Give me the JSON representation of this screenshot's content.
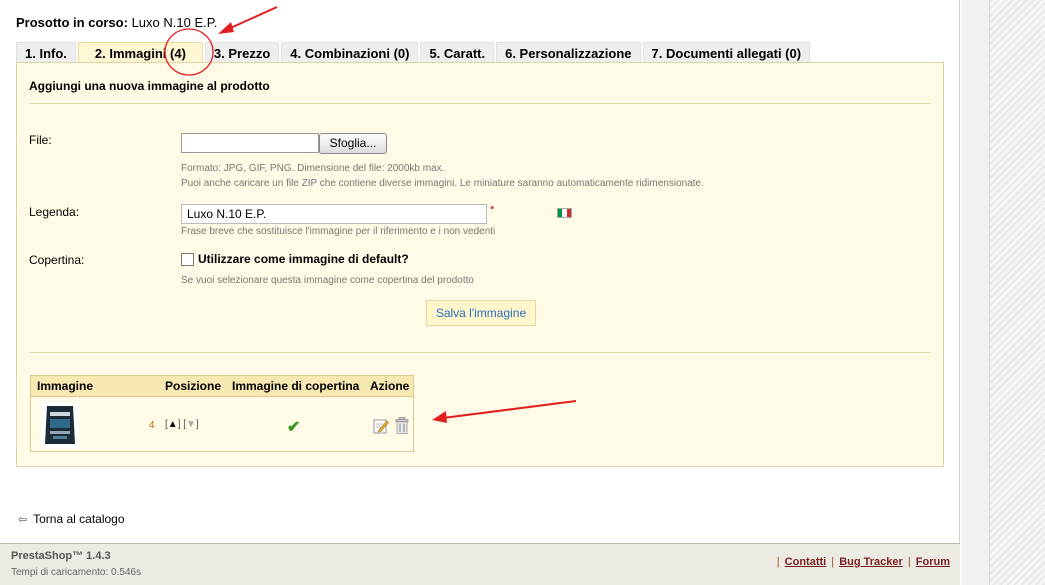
{
  "header": {
    "title_label": "Prosotto in corso:",
    "product_name": "Luxo N.10 E.P."
  },
  "tabs": [
    {
      "label": "1. Info."
    },
    {
      "label": "2. Immagini (4)"
    },
    {
      "label": "3. Prezzo"
    },
    {
      "label": "4. Combinazioni (0)"
    },
    {
      "label": "5. Caratt."
    },
    {
      "label": "6. Personalizzazione"
    },
    {
      "label": "7. Documenti allegati (0)"
    }
  ],
  "form": {
    "heading": "Aggiungi una nuova immagine al prodotto",
    "file_label": "File:",
    "browse_label": "Sfoglia...",
    "file_hint_1": "Formato: JPG, GIF, PNG. Dimensione del file: 2000kb max.",
    "file_hint_2": "Puoi anche caricare un file ZIP che contiene diverse immagini. Le miniature saranno automaticamente ridimensionate.",
    "legend_label": "Legenda:",
    "legend_value": "Luxo N.10 E.P.",
    "required_mark": "*",
    "legend_hint": "Frase breve che sostituisce l'immagine per il riferimento e i non vedenti",
    "cover_label": "Copertina:",
    "cover_checkbox_label": "Utilizzare come immagine di default?",
    "cover_hint": "Se vuoi selezionare questa immagine come copertina del prodotto",
    "save_label": "Salva l'immagine"
  },
  "images_table": {
    "headers": {
      "image": "Immagine",
      "position": "Posizione",
      "cover": "Immagine di copertina",
      "action": "Azione"
    },
    "rows": [
      {
        "position": "4"
      }
    ]
  },
  "back_link": "Torna al catalogo",
  "footer": {
    "brand": "PrestaShop™ 1.4.3",
    "load_time": "Tempi di caricamento: 0.546s",
    "links": [
      "Contatti",
      "Bug Tracker",
      "Forum"
    ]
  },
  "colors": {
    "panel_bg": "#fffbe7",
    "active_tab_bg": "#fff6d3",
    "annotation_red": "#e02020",
    "link_color": "#7a1f1f"
  }
}
